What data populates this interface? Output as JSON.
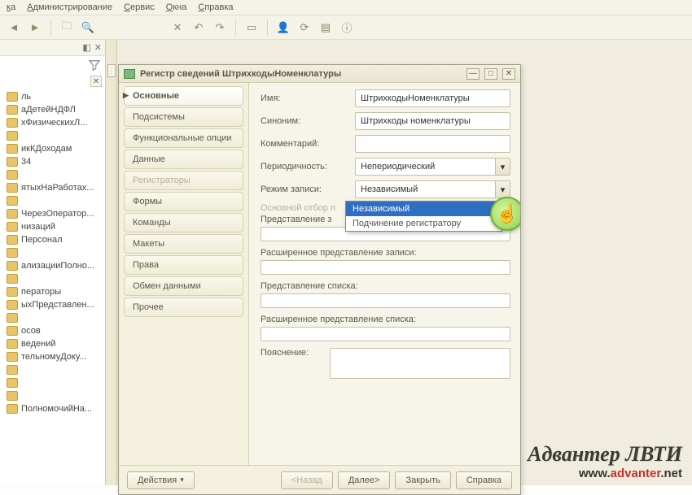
{
  "menu": {
    "items": [
      "ка",
      "Администрирование",
      "Сервис",
      "Окна",
      "Справка"
    ]
  },
  "toolbar": {
    "icons": [
      "back",
      "fwd",
      "folder-search",
      "search",
      "blank",
      "blank",
      "close",
      "undo",
      "redo",
      "sep",
      "page",
      "tools",
      "disk",
      "list",
      "info"
    ]
  },
  "leftpanel": {
    "items": [
      "ль",
      "аДетейНДФЛ",
      "хФизическихЛ...",
      "",
      "икКДоходам",
      "34",
      "",
      "ятыхНаРаботах...",
      "",
      "ЧерезОператор...",
      "низаций",
      "Персонал",
      "",
      "ализацииПолно...",
      "",
      "ператоры",
      "ыхПредставлен...",
      "",
      "осов",
      "ведений",
      "тельномуДоку...",
      "",
      "",
      "",
      "ПолномочийНа..."
    ]
  },
  "dialog": {
    "title": "Регистр сведений ШтрихкодыНоменклатуры",
    "nav": [
      {
        "label": "Основные",
        "active": true
      },
      {
        "label": "Подсистемы"
      },
      {
        "label": "Функциональные опции"
      },
      {
        "label": "Данные"
      },
      {
        "label": "Регистраторы",
        "disabled": true
      },
      {
        "label": "Формы"
      },
      {
        "label": "Команды"
      },
      {
        "label": "Макеты"
      },
      {
        "label": "Права"
      },
      {
        "label": "Обмен данными"
      },
      {
        "label": "Прочее"
      }
    ],
    "form": {
      "name_label": "Имя:",
      "name_value": "ШтрихкодыНоменклатуры",
      "syn_label": "Синоним:",
      "syn_value": "Штрихкоды номенклатуры",
      "comment_label": "Комментарий:",
      "comment_value": "",
      "period_label": "Периодичность:",
      "period_value": "Непериодический",
      "mode_label": "Режим записи:",
      "mode_value": "Независимый",
      "mode_options": [
        "Независимый",
        "Подчинение регистратору"
      ],
      "main_filter_label": "Основной отбор п",
      "repr_record_label": "Представление з",
      "ext_repr_record_label": "Расширенное представление записи:",
      "repr_list_label": "Представление списка:",
      "ext_repr_list_label": "Расширенное представление списка:",
      "explain_label": "Пояснение:"
    },
    "footer": {
      "actions": "Действия",
      "back": "<Назад",
      "next": "Далее>",
      "close": "Закрыть",
      "help": "Справка"
    }
  },
  "watermark": {
    "line1": "Адвантер ЛВТИ",
    "line2a": "www.",
    "line2b": "advanter",
    "line2c": ".net"
  }
}
